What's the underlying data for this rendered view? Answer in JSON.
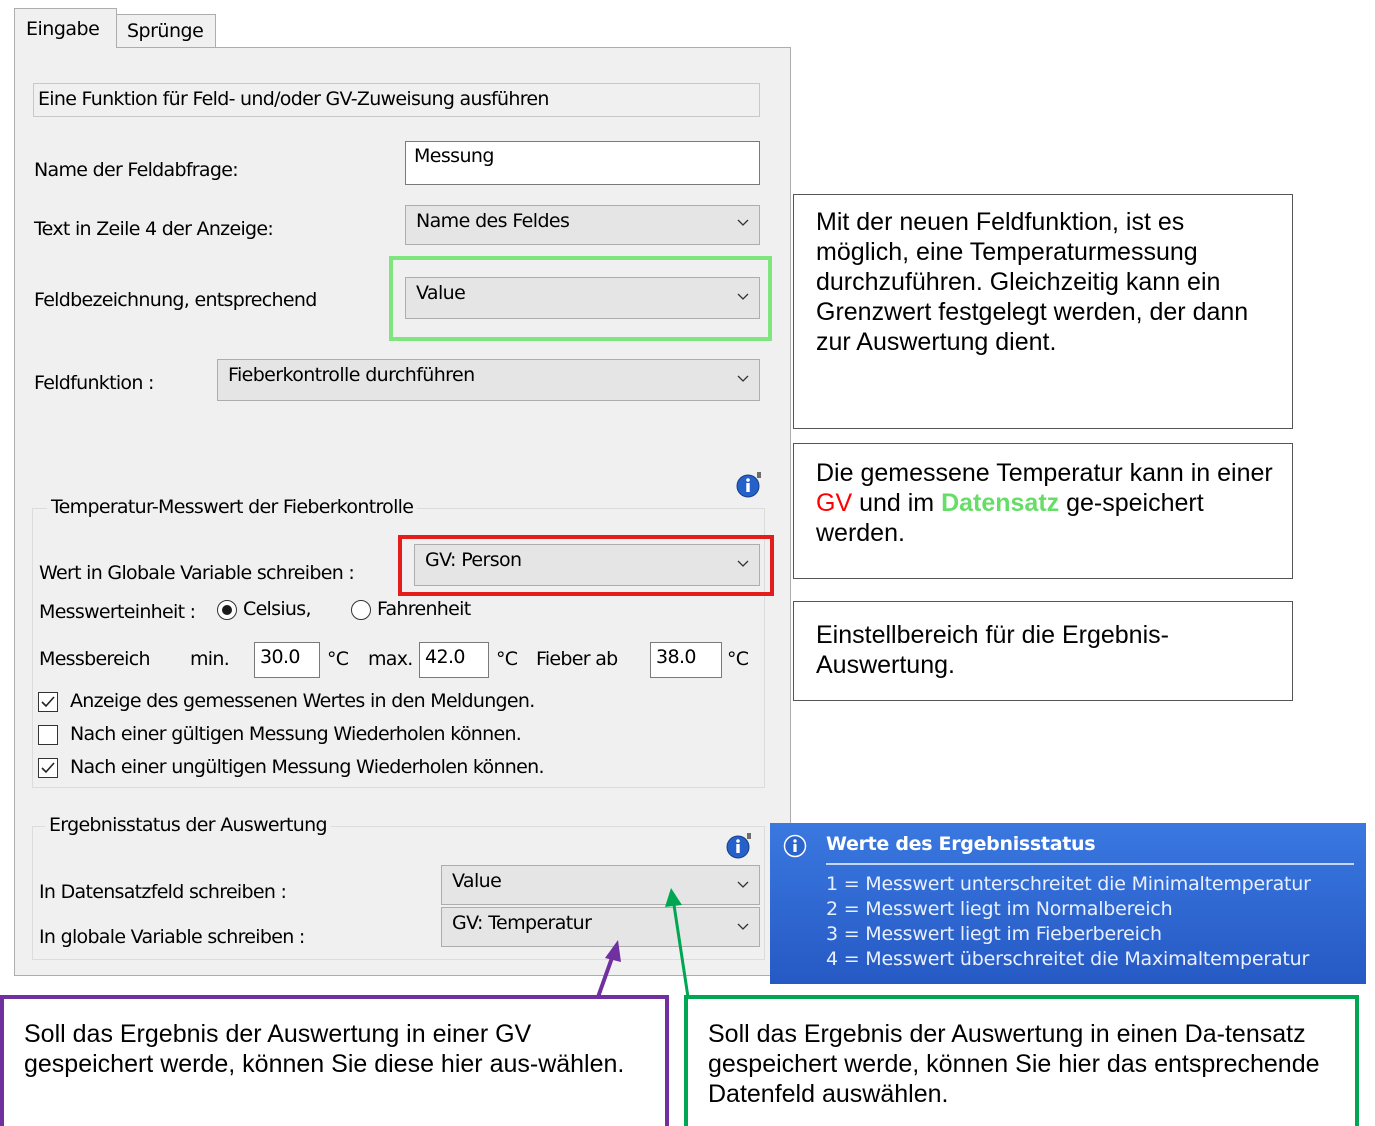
{
  "tabs": [
    {
      "label": "Eingabe",
      "active": true
    },
    {
      "label": "Sprünge",
      "active": false
    }
  ],
  "header": {
    "text": "Eine Funktion für Feld- und/oder GV-Zuweisung ausführen"
  },
  "form": {
    "name_label": "Name der Feldabfrage:",
    "name_value": "Messung",
    "zeile4_label": "Text in Zeile 4 der Anzeige:",
    "zeile4_value": "Name des Feldes",
    "feldbez_label": "Feldbezeichnung, entsprechend",
    "feldbez_value": "Value",
    "feldfunktion_label": "Feldfunktion :",
    "feldfunktion_value": "Fieberkontrolle durchführen"
  },
  "temp_group": {
    "title": "Temperatur-Messwert der Fieberkontrolle",
    "gv_label": "Wert in Globale Variable schreiben :",
    "gv_value": "GV: Person",
    "unit_label": "Messwerteinheit :",
    "celsius": "Celsius,",
    "fahrenheit": "Fahrenheit",
    "range_label": "Messbereich",
    "min_label": "min.",
    "min_value": "30.0",
    "unit1": "°C",
    "max_label": "max.",
    "max_value": "42.0",
    "unit2": "°C",
    "fieber_label": "Fieber ab",
    "fieber_value": "38.0",
    "unit3": "°C",
    "checkbox1": "Anzeige des gemessenen Wertes in den Meldungen.",
    "checkbox1_checked": true,
    "checkbox2": "Nach einer gültigen Messung Wiederholen können.",
    "checkbox2_checked": false,
    "checkbox3": "Nach einer ungültigen Messung Wiederholen können.",
    "checkbox3_checked": true
  },
  "result_group": {
    "title": "Ergebnisstatus der Auswertung",
    "datensatz_label": "In Datensatzfeld schreiben :",
    "datensatz_value": "Value",
    "gv_label": "In globale Variable schreiben :",
    "gv_value": "GV: Temperatur"
  },
  "notes": {
    "note1": "Mit der neuen Feldfunktion, ist es möglich, eine Temperaturmessung durchzuführen. Gleichzeitig kann ein Grenzwert festgelegt werden, der dann zur Auswertung dient.",
    "note2_a": "Die gemessene Temperatur kann in einer ",
    "note2_gv": "GV",
    "note2_b": " und im ",
    "note2_ds": "Datensatz",
    "note2_c": " ge-speichert werden.",
    "note3": "Einstellbereich für die Ergebnis-Auswertung.",
    "note4": "Soll das Ergebnis der Auswertung in einer GV gespeichert werde, können Sie diese hier aus-wählen.",
    "note5": "Soll das Ergebnis der Auswertung in einen Da-tensatz gespeichert werde, können Sie hier das entsprechende Datenfeld auswählen."
  },
  "tooltip": {
    "title": "Werte des Ergebnisstatus",
    "items": [
      "1 = Messwert unterschreitet die Minimaltemperatur",
      "2 = Messwert liegt im Normalbereich",
      "3 = Messwert liegt im Fieberbereich",
      "4 = Messwert überschreitet die Maximaltemperatur"
    ]
  },
  "colors": {
    "green_box": "#7fe57f",
    "red_box": "#e51c1c",
    "purple": "#7030a0",
    "dark_green": "#00a651",
    "gv_text": "#ff0000",
    "datensatz_text": "#66dd66"
  }
}
